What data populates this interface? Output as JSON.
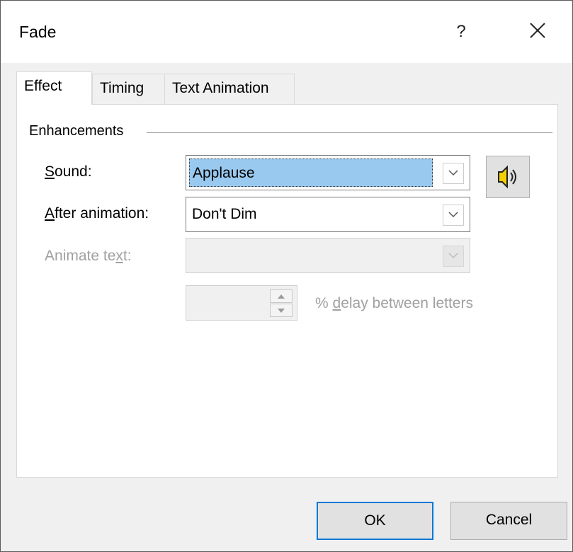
{
  "window": {
    "title": "Fade",
    "help_label": "?"
  },
  "tabs": [
    {
      "label": "Effect",
      "active": true
    },
    {
      "label": "Timing",
      "active": false
    },
    {
      "label": "Text Animation",
      "active": false
    }
  ],
  "enhancements": {
    "group_label": "Enhancements",
    "sound": {
      "label_mnemonic": "S",
      "label_rest": "ound:",
      "value": "Applause"
    },
    "after_animation": {
      "label_mnemonic": "A",
      "label_rest": "fter animation:",
      "value": "Don't Dim"
    },
    "animate_text": {
      "label_pre": "Animate te",
      "label_mnemonic": "x",
      "label_rest": "t:",
      "value": ""
    },
    "delay": {
      "value": "",
      "label_pre": "% ",
      "label_mnemonic": "d",
      "label_rest": "elay between letters"
    }
  },
  "buttons": {
    "ok": "OK",
    "cancel": "Cancel"
  },
  "icons": {
    "sound_preview": "speaker-icon",
    "close": "close-icon",
    "dropdown": "chevron-down-icon"
  },
  "colors": {
    "selection": "#99c9ef",
    "default_button_border": "#0078d7",
    "disabled_text": "#a0a0a0"
  }
}
